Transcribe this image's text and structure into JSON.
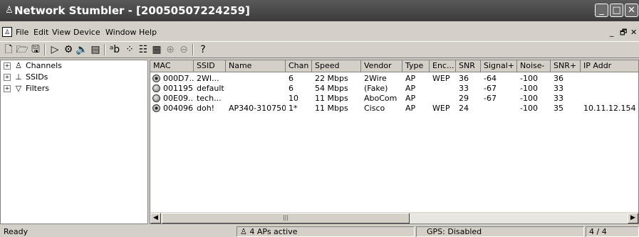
{
  "window": {
    "title": "Network Stumbler - [20050507224259]",
    "caption_buttons": {
      "minimize": "_",
      "maximize": "□",
      "close": "✕"
    }
  },
  "menu": {
    "items": [
      "File",
      "Edit",
      "View",
      "Device",
      "Window",
      "Help"
    ],
    "mdi_buttons": {
      "minimize": "_",
      "restore": "🗗",
      "close": "✕"
    }
  },
  "toolbar": {
    "icons": [
      "new-icon",
      "open-icon",
      "save-icon",
      "start-scan-icon",
      "auto-config-icon",
      "speaker-icon",
      "properties-icon",
      "rename-icon",
      "large-icons-icon",
      "list-view-icon",
      "details-view-icon",
      "zoom-in-icon",
      "zoom-out-icon",
      "help-icon"
    ]
  },
  "tree": {
    "items": [
      {
        "label": "Channels",
        "icon": "antenna-icon"
      },
      {
        "label": "SSIDs",
        "icon": "network-icon"
      },
      {
        "label": "Filters",
        "icon": "filter-icon"
      }
    ]
  },
  "list": {
    "columns": [
      "MAC",
      "SSID",
      "Name",
      "Chan",
      "Speed",
      "Vendor",
      "Type",
      "Enc...",
      "SNR",
      "Signal+",
      "Noise-",
      "SNR+",
      "IP Addr"
    ],
    "rows": [
      {
        "icon": "locked-ap-icon",
        "cells": [
          "000D7...",
          "2WI...",
          "",
          "6",
          "22 Mbps",
          "2Wire",
          "AP",
          "WEP",
          "36",
          "-64",
          "-100",
          "36",
          ""
        ]
      },
      {
        "icon": "inactive-ap-icon",
        "cells": [
          "001195...",
          "default",
          "",
          "6",
          "54 Mbps",
          "(Fake)",
          "AP",
          "",
          "33",
          "-67",
          "-100",
          "33",
          ""
        ]
      },
      {
        "icon": "inactive-ap-icon",
        "cells": [
          "00E09...",
          "tech...",
          "",
          "10",
          "11 Mbps",
          "AboCom",
          "AP",
          "",
          "29",
          "-67",
          "-100",
          "33",
          ""
        ]
      },
      {
        "icon": "locked-ap-icon",
        "cells": [
          "004096...",
          "doh!",
          "AP340-310750",
          "1*",
          "11 Mbps",
          "Cisco",
          "AP",
          "WEP",
          "24",
          "",
          "-100",
          "35",
          "10.11.12.154"
        ]
      }
    ]
  },
  "status": {
    "ready": "Ready",
    "aps": "4 APs active",
    "gps": "GPS: Disabled",
    "count": "4 / 4"
  }
}
